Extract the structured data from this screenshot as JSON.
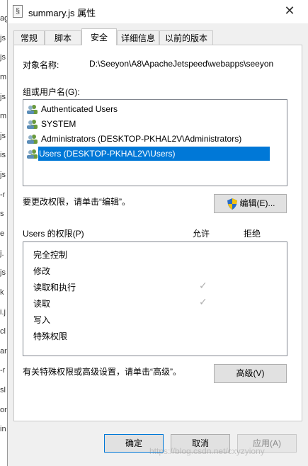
{
  "background_fragments": [
    "ag",
    "js",
    "js",
    "m",
    "js",
    "m",
    "js",
    "is",
    "js",
    "-r",
    "s",
    "e",
    "j.",
    "js",
    "k",
    "i.j",
    "cl",
    "ar",
    "-r",
    "sl",
    "or",
    "in"
  ],
  "window": {
    "title": "summary.js 属性",
    "close_glyph": "✕"
  },
  "tabs": [
    {
      "label": "常规",
      "active": false
    },
    {
      "label": "脚本",
      "active": false
    },
    {
      "label": "安全",
      "active": true
    },
    {
      "label": "详细信息",
      "active": false
    },
    {
      "label": "以前的版本",
      "active": false
    }
  ],
  "security": {
    "object_name_label": "对象名称:",
    "object_name_value": "D:\\Seeyon\\A8\\ApacheJetspeed\\webapps\\seeyon",
    "groups_label": "组或用户名(G):",
    "users": [
      {
        "name": "Authenticated Users",
        "selected": false
      },
      {
        "name": "SYSTEM",
        "selected": false
      },
      {
        "name": "Administrators (DESKTOP-PKHAL2V\\Administrators)",
        "selected": false
      },
      {
        "name": "Users (DESKTOP-PKHAL2V\\Users)",
        "selected": true
      }
    ],
    "edit_hint": "要更改权限，请单击“编辑”。",
    "edit_button": "编辑(E)...",
    "permissions_label": "Users 的权限(P)",
    "allow_header": "允许",
    "deny_header": "拒绝",
    "permissions": [
      {
        "name": "完全控制",
        "allow": false
      },
      {
        "name": "修改",
        "allow": false
      },
      {
        "name": "读取和执行",
        "allow": true
      },
      {
        "name": "读取",
        "allow": true
      },
      {
        "name": "写入",
        "allow": false
      },
      {
        "name": "特殊权限",
        "allow": false
      }
    ],
    "check_glyph": "✓",
    "advanced_hint": "有关特殊权限或高级设置，请单击“高级”。",
    "advanced_button": "高级(V)"
  },
  "footer": {
    "ok_button": "确定",
    "cancel_button": "取消",
    "apply_button": "应用(A)"
  },
  "watermark": "https://blog.csdn.net/cxyzyiony",
  "colors": {
    "selection": "#0078d7",
    "dialog_bg": "#f0f0f0",
    "shield_blue": "#2b6cc4",
    "shield_yellow": "#f4c20d"
  }
}
